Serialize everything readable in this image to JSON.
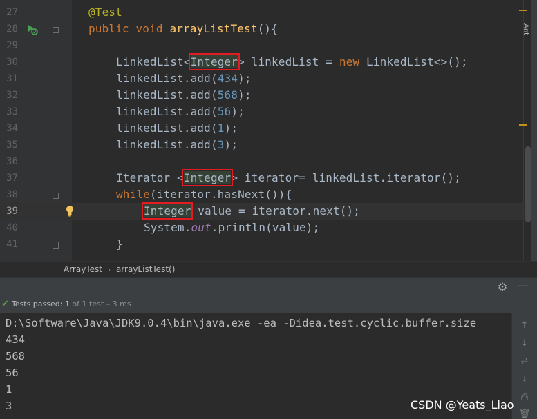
{
  "editor": {
    "lines": [
      {
        "num": "27"
      },
      {
        "num": "28"
      },
      {
        "num": "29"
      },
      {
        "num": "30"
      },
      {
        "num": "31"
      },
      {
        "num": "32"
      },
      {
        "num": "33"
      },
      {
        "num": "34"
      },
      {
        "num": "35"
      },
      {
        "num": "36"
      },
      {
        "num": "37"
      },
      {
        "num": "38"
      },
      {
        "num": "39"
      },
      {
        "num": "40"
      },
      {
        "num": "41"
      }
    ],
    "code": {
      "l27_ann": "@Test",
      "l28_public": "public",
      "l28_void": "void",
      "l28_name": "arrayListTest",
      "l28_rest": "(){",
      "l30_type": "LinkedList<",
      "l30_generic": "Integer",
      "l30_rest1": "> linkedList = ",
      "l30_new": "new",
      "l30_rest2": " LinkedList<>();",
      "add_prefix": "linkedList.add(",
      "add_suffix": ");",
      "v31": "434",
      "v32": "568",
      "v33": "56",
      "v34": "1",
      "v35": "3",
      "l37_type": "Iterator <",
      "l37_generic": "Integer",
      "l37_rest": "> iterator= linkedList.iterator();",
      "l38_while": "while",
      "l38_rest": "(iterator.hasNext()){",
      "l39_type": "Integer",
      "l39_rest": " value = iterator.next();",
      "l40_system": "System.",
      "l40_out": "out",
      "l40_rest": ".println(value);",
      "l41_brace": "}"
    }
  },
  "right_strip_label": "Ant",
  "breadcrumb": {
    "class_name": "ArrayTest",
    "separator": "›",
    "method_name": "arrayListTest()"
  },
  "run_window": {
    "settings_icon": "⚙",
    "minimize_icon": "—",
    "status": {
      "check": "✔",
      "label": "Tests passed: ",
      "passed": "1",
      "detail": " of 1 test – 3 ms"
    },
    "console_lines": [
      "D:\\Software\\Java\\JDK9.0.4\\bin\\java.exe -ea -Didea.test.cyclic.buffer.size",
      "434",
      "568",
      "56",
      "1",
      "3"
    ],
    "toolbar_icons": [
      "↑",
      "↓",
      "⇌",
      "⤓",
      "⎙",
      "🗑"
    ]
  },
  "watermark": "CSDN @Yeats_Liao",
  "colors": {
    "background": "#2b2b2b",
    "gutter": "#313335",
    "keyword": "#cc7832",
    "method": "#ffc66d",
    "number": "#6897bb",
    "annotation": "#bbb529",
    "highlight_box": "#e31b23",
    "pass_green": "#5b9e45"
  }
}
